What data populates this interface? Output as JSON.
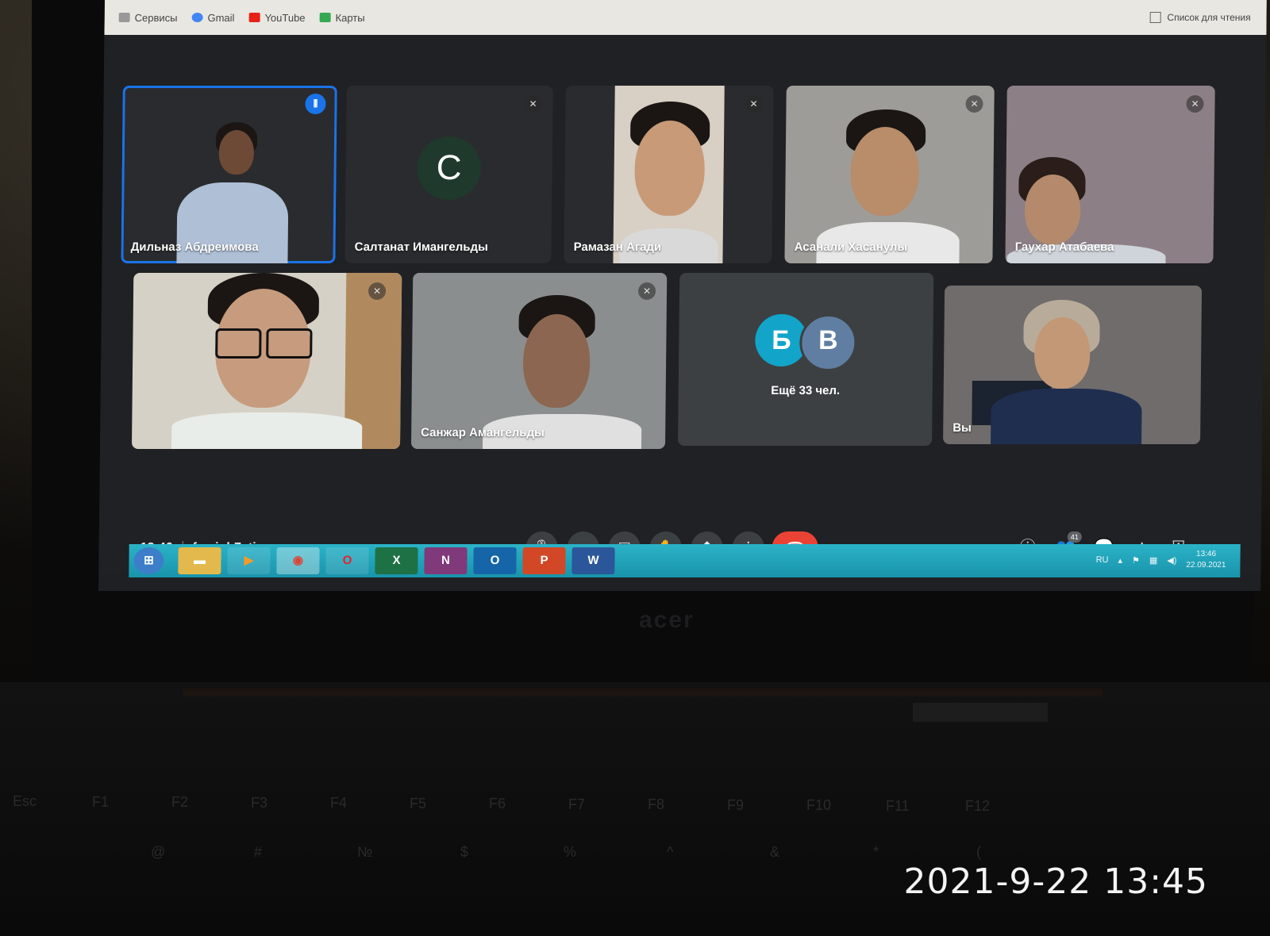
{
  "browser": {
    "bookmarks": [
      {
        "label": "Сервисы",
        "icon": "apps-grid-icon",
        "color": "#888888"
      },
      {
        "label": "Gmail",
        "icon": "google-g-icon",
        "color": "#4285f4"
      },
      {
        "label": "YouTube",
        "icon": "youtube-icon",
        "color": "#e62117"
      },
      {
        "label": "Карты",
        "icon": "maps-icon",
        "color": "#34a853"
      }
    ],
    "reading_list": "Список для чтения"
  },
  "meet": {
    "participants": [
      {
        "name": "Дильназ Абдреимова",
        "state": "speaking"
      },
      {
        "name": "Салтанат Имангельды",
        "avatar_letter": "С",
        "state": "muted"
      },
      {
        "name": "Рамазан Агади",
        "state": "muted"
      },
      {
        "name": "Асанали Хасанулы",
        "state": "muted"
      },
      {
        "name": "Гаухар Атабаева",
        "state": "muted"
      },
      {
        "name": "",
        "state": "muted"
      },
      {
        "name": "Санжар Амангельды",
        "state": "muted"
      },
      {
        "name": "Вы",
        "state": "self"
      }
    ],
    "more": {
      "letters": [
        "Б",
        "В"
      ],
      "text": "Ещё 33 чел."
    },
    "time": "13:46",
    "meeting_code": "fmsjuh7cti",
    "participant_count": "41",
    "accent": "#1a73e8",
    "end_color": "#ea4335"
  },
  "taskbar": {
    "apps": [
      "start",
      "explorer",
      "media-player",
      "chrome",
      "opera",
      "X",
      "N",
      "O",
      "P",
      "W"
    ],
    "lang": "RU",
    "time": "13:46",
    "date": "22.09.2021",
    "color": "#1fa3bb"
  },
  "laptop_brand": "acer",
  "keyboard": {
    "fkeys": [
      "Esc",
      "F1",
      "F2",
      "F3",
      "F4",
      "F5",
      "F6",
      "F7",
      "F8",
      "F9",
      "F10",
      "F11",
      "F12"
    ],
    "numrow": [
      "@",
      "#",
      "№",
      "$",
      "%",
      "^",
      "&",
      "*",
      "("
    ]
  },
  "photo_timestamp": "2021-9-22 13:45"
}
